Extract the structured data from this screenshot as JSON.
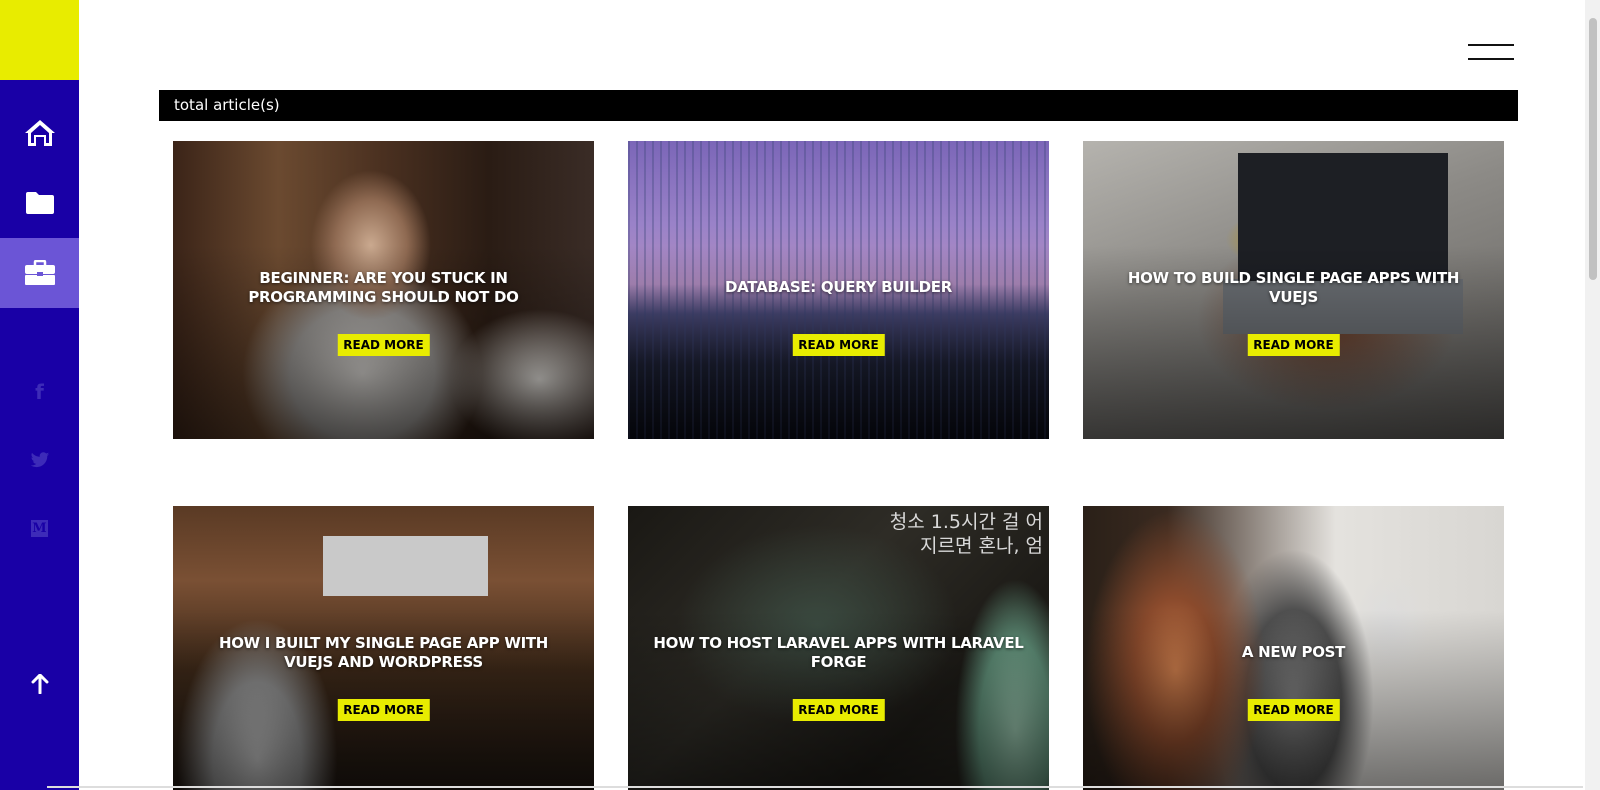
{
  "header": {
    "total_label": "total article(s)"
  },
  "sidebar": {
    "nav": [
      {
        "icon": "home-icon"
      },
      {
        "icon": "folder-icon"
      },
      {
        "icon": "briefcase-icon",
        "active": true
      }
    ],
    "social": [
      {
        "icon": "facebook-icon",
        "glyph": "f"
      },
      {
        "icon": "twitter-icon"
      },
      {
        "icon": "medium-icon",
        "glyph": "M"
      }
    ],
    "back_to_top_icon": "arrow-up-icon"
  },
  "colors": {
    "sidebar": "#1900a6",
    "accent": "#e8ec00",
    "active_nav": "#6b55d6"
  },
  "articles": [
    {
      "title": "BEGINNER: ARE YOU STUCK IN PROGRAMMING SHOULD NOT DO",
      "read_more": "READ MORE"
    },
    {
      "title": "DATABASE: QUERY BUILDER",
      "read_more": "READ MORE"
    },
    {
      "title": "HOW TO BUILD SINGLE PAGE APPS WITH VUEJS",
      "read_more": "READ MORE"
    },
    {
      "title": "HOW I BUILT MY SINGLE PAGE APP WITH VUEJS AND WORDPRESS",
      "read_more": "READ MORE"
    },
    {
      "title": "HOW TO HOST LARAVEL APPS WITH LARAVEL FORGE",
      "read_more": "READ MORE",
      "image_text": "청소 1.5시간 걸 어지르면 혼나, 엄"
    },
    {
      "title": "A NEW POST",
      "read_more": "READ MORE"
    }
  ]
}
